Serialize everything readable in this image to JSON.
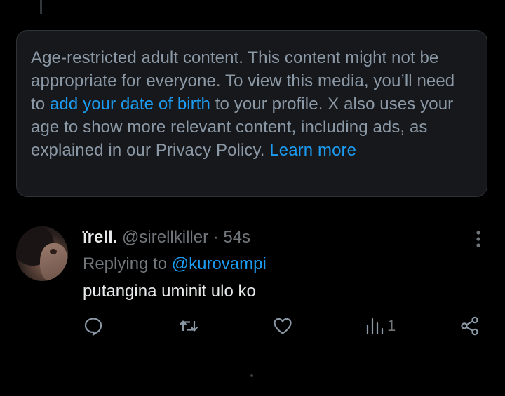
{
  "notice": {
    "text_1": "Age-restricted adult content. This content might not be appropriate for everyone. To view this media, you’ll need to ",
    "link_dob": "add your date of birth",
    "text_2": " to your profile. X also uses your age to show more relevant content, including ads, as explained in our Privacy Policy. ",
    "link_learn_more": "Learn more"
  },
  "tweet": {
    "display_name": "ïrell.",
    "handle": "@sirellkiller",
    "separator": " · ",
    "time": "54s",
    "replying_label": "Replying to ",
    "replying_to": "@kurovampi",
    "text": "putangina uminit ulo ko",
    "views": "1"
  },
  "icons": {
    "more": "more-vertical-icon",
    "reply": "reply-icon",
    "repost": "repost-icon",
    "like": "heart-icon",
    "views": "views-icon",
    "share": "share-icon"
  },
  "colors": {
    "background": "#000000",
    "card": "#16181c",
    "link": "#1d9bf0",
    "muted": "#71767b",
    "text": "#e7e9ea"
  }
}
